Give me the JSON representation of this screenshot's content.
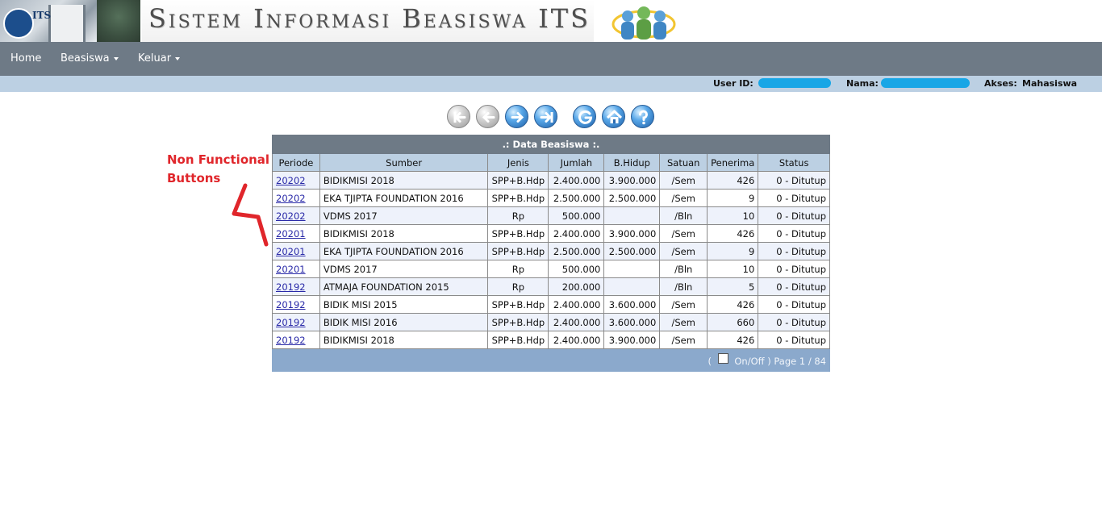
{
  "header": {
    "logo_text": "ITS",
    "title": "Sistem Informasi Beasiswa ITS"
  },
  "nav": {
    "home": "Home",
    "beasiswa": "Beasiswa",
    "keluar": "Keluar"
  },
  "userbar": {
    "user_id_label": "User ID:",
    "nama_label": "Nama:",
    "akses_label": "Akses:",
    "akses_value": "Mahasiswa",
    "redaction_color": "#18a6e6"
  },
  "toolbar": {
    "icons": [
      "first-icon",
      "prev-icon",
      "next-icon",
      "last-icon",
      "go-icon",
      "home-icon",
      "help-icon"
    ]
  },
  "annotation": {
    "text_line1": "Non Functional",
    "text_line2": "Buttons",
    "color": "#e0262b"
  },
  "table": {
    "caption": ".: Data Beasiswa :.",
    "columns": [
      "Periode",
      "Sumber",
      "Jenis",
      "Jumlah",
      "B.Hidup",
      "Satuan",
      "Penerima",
      "Status"
    ],
    "rows": [
      [
        "20202",
        "BIDIKMISI 2018",
        "SPP+B.Hdp",
        "2.400.000",
        "3.900.000",
        "/Sem",
        "426",
        "0 - Ditutup"
      ],
      [
        "20202",
        "EKA TJIPTA FOUNDATION 2016",
        "SPP+B.Hdp",
        "2.500.000",
        "2.500.000",
        "/Sem",
        "9",
        "0 - Ditutup"
      ],
      [
        "20202",
        "VDMS 2017",
        "Rp",
        "500.000",
        "",
        "/Bln",
        "10",
        "0 - Ditutup"
      ],
      [
        "20201",
        "BIDIKMISI 2018",
        "SPP+B.Hdp",
        "2.400.000",
        "3.900.000",
        "/Sem",
        "426",
        "0 - Ditutup"
      ],
      [
        "20201",
        "EKA TJIPTA FOUNDATION 2016",
        "SPP+B.Hdp",
        "2.500.000",
        "2.500.000",
        "/Sem",
        "9",
        "0 - Ditutup"
      ],
      [
        "20201",
        "VDMS 2017",
        "Rp",
        "500.000",
        "",
        "/Bln",
        "10",
        "0 - Ditutup"
      ],
      [
        "20192",
        "ATMAJA FOUNDATION 2015",
        "Rp",
        "200.000",
        "",
        "/Bln",
        "5",
        "0 - Ditutup"
      ],
      [
        "20192",
        "BIDIK MISI 2015",
        "SPP+B.Hdp",
        "2.400.000",
        "3.600.000",
        "/Sem",
        "426",
        "0 - Ditutup"
      ],
      [
        "20192",
        "BIDIK MISI 2016",
        "SPP+B.Hdp",
        "2.400.000",
        "3.600.000",
        "/Sem",
        "660",
        "0 - Ditutup"
      ],
      [
        "20192",
        "BIDIKMISI 2018",
        "SPP+B.Hdp",
        "2.400.000",
        "3.900.000",
        "/Sem",
        "426",
        "0 - Ditutup"
      ]
    ],
    "footer": {
      "open_paren": "(",
      "onoff_label": "On/Off",
      "page_text": ") Page 1 / 84"
    }
  }
}
